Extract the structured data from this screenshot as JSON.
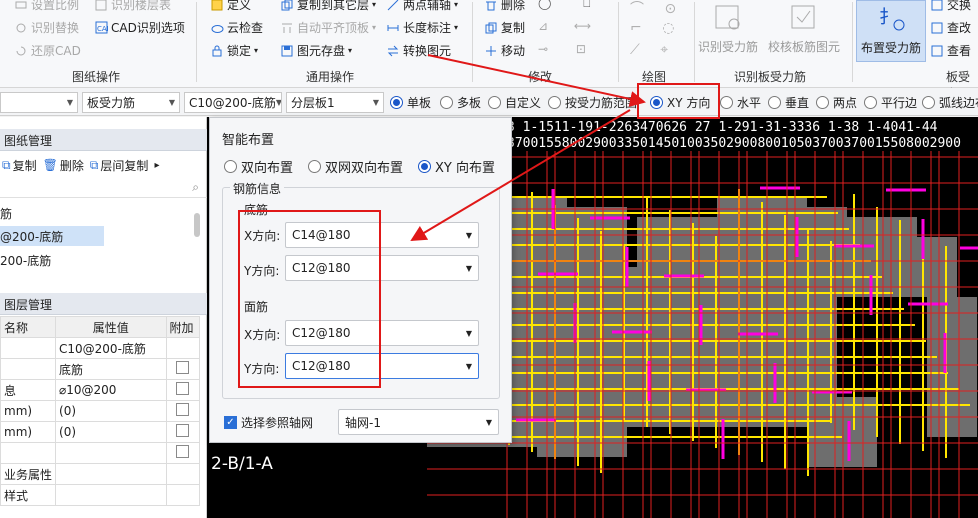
{
  "ribbon": {
    "drawing_ops": {
      "items": [
        "设置比例",
        "识别楼层表",
        "识别替换",
        "CAD识别选项",
        "还原CAD"
      ],
      "label": "图纸操作"
    },
    "general_ops": {
      "items": [
        "定义",
        "复制到其它层",
        "两点辅轴",
        "云检查",
        "自动平齐顶板",
        "长度标注",
        "锁定",
        "图元存盘",
        "转换图元"
      ],
      "label": "通用操作"
    },
    "modify": {
      "items": [
        "删除",
        "复制",
        "移动"
      ],
      "label": "修改"
    },
    "draw": {
      "label": "绘图"
    },
    "identify_rebar": {
      "buttons": [
        "识别受力筋",
        "校核板筋图元"
      ],
      "label": "识别板受力筋"
    },
    "layout_rebar": {
      "button": "布置受力筋"
    },
    "board_rebar": {
      "items": [
        "交换",
        "查改",
        "查看"
      ],
      "label": "板受力"
    }
  },
  "toolbar": {
    "selects": [
      "",
      "板受力筋",
      "C10@200-底筋",
      "分层板1"
    ],
    "radios": [
      {
        "label": "单板",
        "checked": true
      },
      {
        "label": "多板",
        "checked": false
      },
      {
        "label": "自定义",
        "checked": false
      },
      {
        "label": "按受力筋范围",
        "checked": false
      },
      {
        "label": "XY 方向",
        "checked": true
      },
      {
        "label": "水平",
        "checked": false
      },
      {
        "label": "垂直",
        "checked": false
      },
      {
        "label": "两点",
        "checked": false
      },
      {
        "label": "平行边",
        "checked": false
      },
      {
        "label": "弧线边布",
        "checked": false
      }
    ]
  },
  "drawing_panel": {
    "title": "图纸管理",
    "toolbar": [
      "复制",
      "删除",
      "层间复制"
    ],
    "tree": [
      "筋",
      "@200-底筋",
      "200-底筋"
    ]
  },
  "layer_panel": {
    "title": "图层管理"
  },
  "props": {
    "headers": [
      "名称",
      "属性值",
      "附加"
    ],
    "rows": [
      {
        "name": "",
        "value": "C10@200-底筋"
      },
      {
        "name": "",
        "value": "底筋"
      },
      {
        "name": "息",
        "value": "⌀10@200"
      },
      {
        "name": "mm)",
        "value": "(0)"
      },
      {
        "name": "mm)",
        "value": "(0)"
      },
      {
        "name": "",
        "value": ""
      },
      {
        "name": "业务属性",
        "value": ""
      },
      {
        "name": "样式",
        "value": ""
      }
    ]
  },
  "dialog": {
    "title": "智能布置",
    "modes": [
      {
        "label": "双向布置",
        "checked": false
      },
      {
        "label": "双网双向布置",
        "checked": false
      },
      {
        "label": "XY 向布置",
        "checked": true
      }
    ],
    "section_title": "钢筋信息",
    "bottom_label": "底筋",
    "top_label": "面筋",
    "x_label": "X方向:",
    "y_label": "Y方向:",
    "bottom_x": "C14@180",
    "bottom_y": "C12@180",
    "top_x": "C12@180",
    "top_y": "C12@180",
    "ref_axis_label": "选择参照轴网",
    "ref_axis_value": "轴网-1"
  },
  "canvas": {
    "axis_labels": "3  1-1511-191-2263470626 27  1-291-31-3336  1-38  1-4041-44",
    "dims": "3700155800290033501450100350290080010503700370015508002900",
    "left_axis": "2-B/1-A",
    "colors": {
      "axis": "#e02020",
      "beam": "#ffe600",
      "rebar": "#ff00e0",
      "slab": "#6e6e6e"
    }
  }
}
